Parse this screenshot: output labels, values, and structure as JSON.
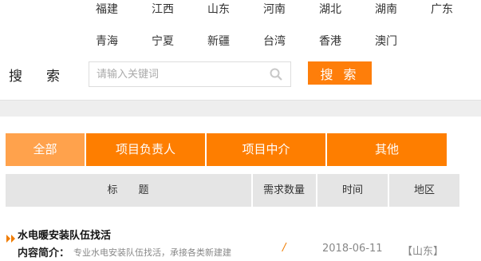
{
  "provinces": [
    "福建",
    "江西",
    "山东",
    "河南",
    "湖北",
    "湖南",
    "广东",
    "青海",
    "宁夏",
    "新疆",
    "台湾",
    "香港",
    "澳门"
  ],
  "search": {
    "label_1": "搜",
    "label_2": "索",
    "placeholder": "请输入关键词",
    "button": "搜 索",
    "icon": "search-icon"
  },
  "tabs": [
    {
      "label": "全部",
      "active": true
    },
    {
      "label": "项目负责人",
      "active": false
    },
    {
      "label": "项目中介",
      "active": false
    },
    {
      "label": "其他",
      "active": false
    }
  ],
  "table": {
    "headers": [
      "标　　题",
      "需求数量",
      "时间",
      "地区"
    ]
  },
  "rows": [
    {
      "title": "水电暖安装队伍找活",
      "intro_label": "内容简介：",
      "intro": "专业水电安装队伍找活，承接各类新建建",
      "quantity": "/",
      "date": "2018-06-11",
      "region": "【山东】"
    }
  ],
  "colors": {
    "accent": "#fe7e00",
    "tab_active": "#ffa24c",
    "header_bg": "#e5e5e5"
  }
}
